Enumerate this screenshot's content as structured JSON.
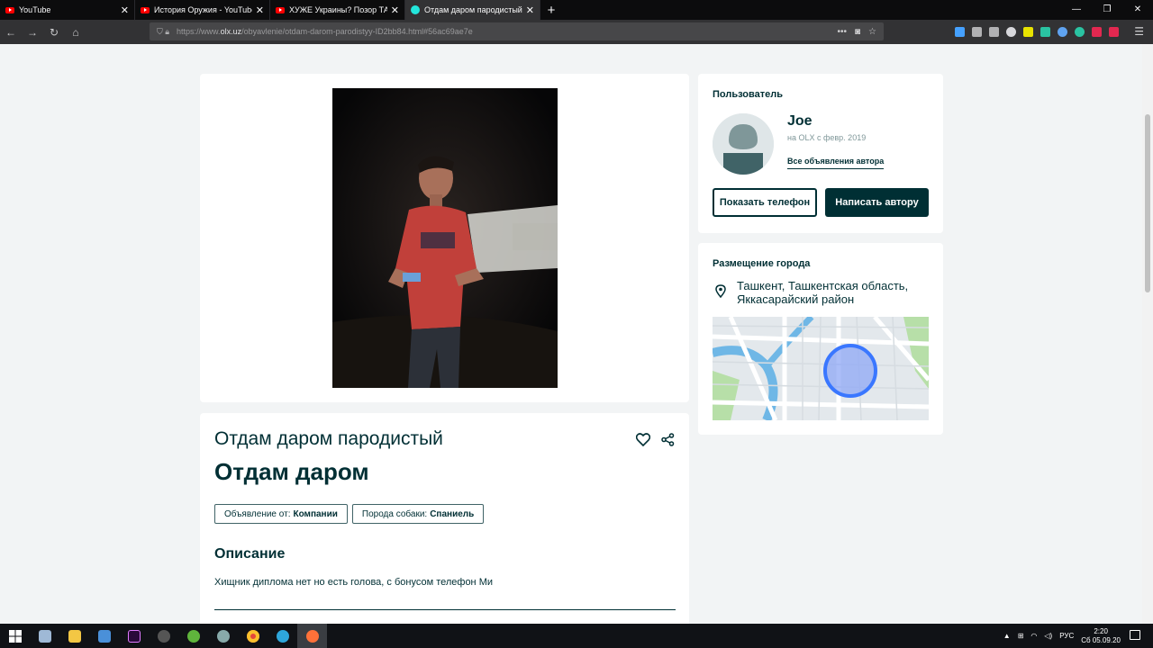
{
  "browser": {
    "tabs": [
      {
        "title": "YouTube",
        "icon": "youtube-icon",
        "active": false
      },
      {
        "title": "История Оружия - YouTube",
        "icon": "youtube-icon",
        "active": false
      },
      {
        "title": "ХУЖЕ Украины? Позор ТАНК",
        "icon": "youtube-icon",
        "active": false
      },
      {
        "title": "Отдам даром пародистый: Ол",
        "icon": "olx-icon",
        "active": true
      }
    ],
    "new_tab_label": "+",
    "url_prefix": "https://www.",
    "url_domain": "olx.uz",
    "url_path": "/obyavlenie/otdam-darom-parodistyy-ID2bb84.html#56ac69ae7e"
  },
  "listing": {
    "subtitle": "Отдам даром пародистый",
    "title": "Отдам даром",
    "chips": [
      {
        "label": "Объявление от:",
        "value": "Компании"
      },
      {
        "label": "Порода собаки:",
        "value": "Спаниель"
      }
    ],
    "description_heading": "Описание",
    "description": "Хищник диплома нет но есть голова, с бонусом телефон Ми"
  },
  "seller": {
    "section_label": "Пользователь",
    "name": "Joe",
    "since": "на OLX с февр. 2019",
    "all_ads_link": "Все объявления автора",
    "show_phone_button": "Показать телефон",
    "message_button": "Написать автору"
  },
  "location": {
    "section_label": "Размещение города",
    "address": "Ташкент, Ташкентская область, Яккасарайский район"
  },
  "taskbar": {
    "language": "РУС",
    "time": "2:20",
    "date": "Сб 05.09.20"
  },
  "colors": {
    "primary": "#002f34",
    "page_bg": "#f2f4f5",
    "map_marker": "#3a77ff"
  }
}
